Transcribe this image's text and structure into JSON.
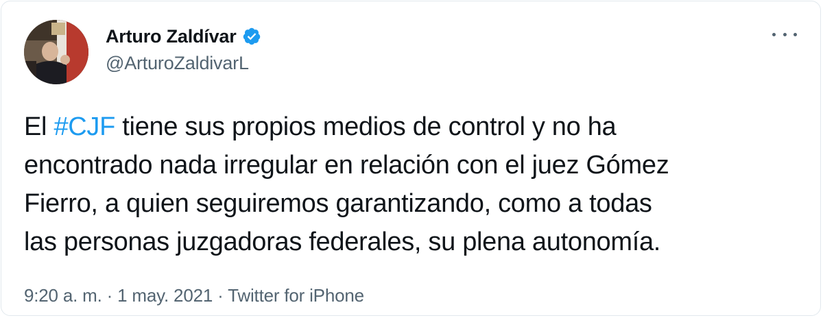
{
  "author": {
    "display_name": "Arturo Zaldívar",
    "handle": "@ArturoZaldivarL",
    "verified_icon": "verified-badge-icon",
    "avatar": "profile-photo"
  },
  "more_icon": "more-horizontal-icon",
  "tweet": {
    "line1_prefix": "El ",
    "hashtag": "#CJF",
    "line1_suffix": " tiene sus propios medios de control y no ha",
    "line2": "encontrado nada irregular en relación con el juez Gómez",
    "line3": "Fierro, a quien seguiremos garantizando, como a todas",
    "line4": "las personas juzgadoras federales, su plena autonomía."
  },
  "meta": {
    "time": "9:20 a. m.",
    "separator": " · ",
    "date": "1 may. 2021",
    "source": "Twitter for iPhone"
  },
  "colors": {
    "link": "#1d9bf0",
    "text": "#0f1419",
    "secondary": "#536471",
    "verified": "#1d9bf0"
  }
}
